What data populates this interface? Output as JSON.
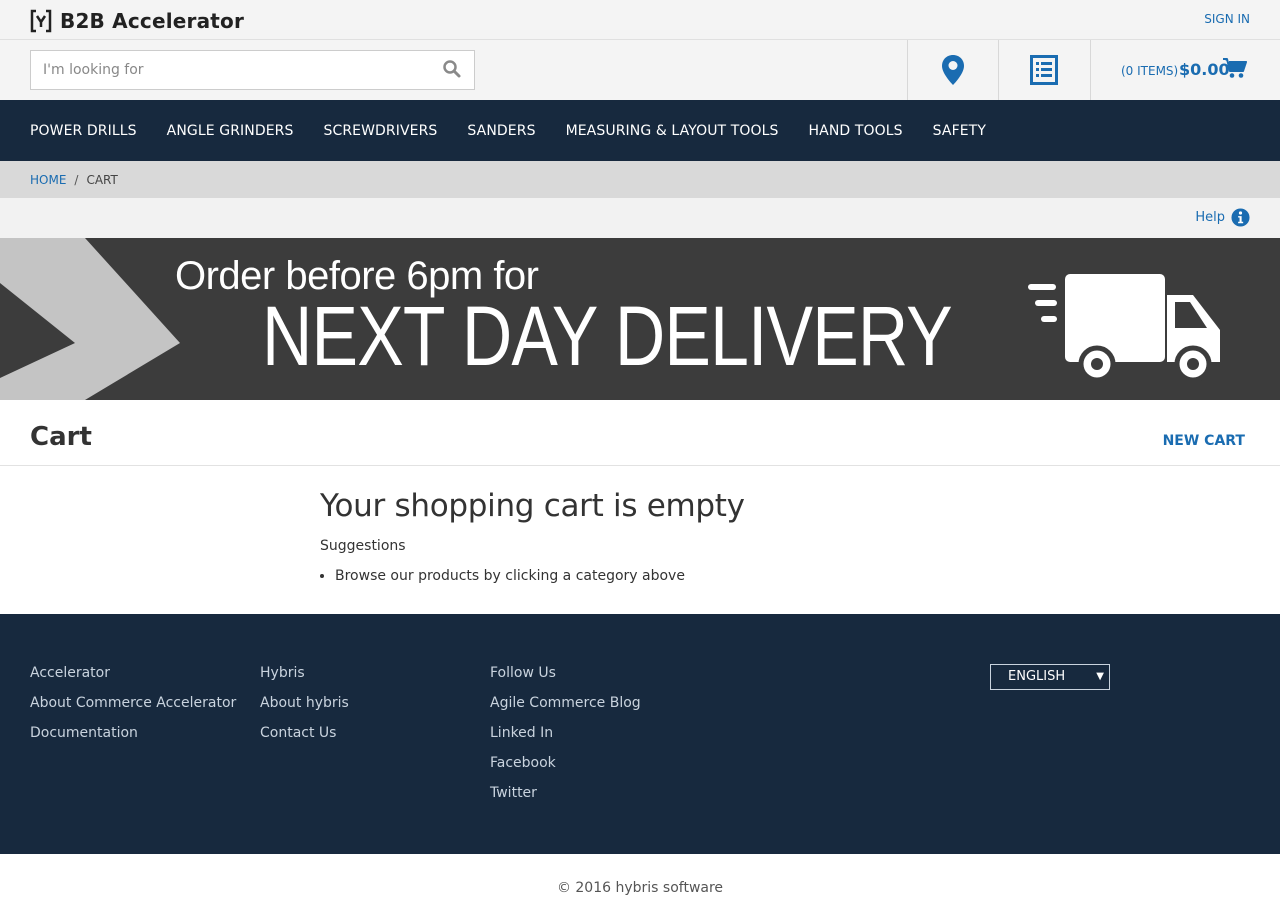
{
  "header": {
    "logo_text": "B2B Accelerator",
    "sign_in": "SIGN IN"
  },
  "search": {
    "placeholder": "I'm looking for"
  },
  "minicart": {
    "items": "(0 ITEMS)",
    "total": "$0.00"
  },
  "nav": {
    "items": [
      "POWER DRILLS",
      "ANGLE GRINDERS",
      "SCREWDRIVERS",
      "SANDERS",
      "MEASURING & LAYOUT TOOLS",
      "HAND TOOLS",
      "SAFETY"
    ]
  },
  "breadcrumb": {
    "home": "HOME",
    "separator": "/",
    "current": "CART"
  },
  "help": {
    "label": "Help"
  },
  "banner": {
    "line1": "Order before 6pm for",
    "line2": "NEXT DAY DELIVERY"
  },
  "cart": {
    "title": "Cart",
    "new_cart": "NEW CART",
    "empty_heading": "Your shopping cart is empty",
    "suggestions_label": "Suggestions",
    "suggestions": [
      "Browse our products by clicking a category above"
    ]
  },
  "footer": {
    "columns": [
      {
        "heading": "Accelerator",
        "links": [
          "About Commerce Accelerator",
          "Documentation"
        ]
      },
      {
        "heading": "Hybris",
        "links": [
          "About hybris",
          "Contact Us"
        ]
      },
      {
        "heading": "Follow Us",
        "links": [
          "Agile Commerce Blog",
          "Linked In",
          "Facebook",
          "Twitter"
        ]
      }
    ],
    "language": "ENGLISH",
    "copyright": "© 2016 hybris software"
  },
  "colors": {
    "accent": "#1a6cb1",
    "nav_bg": "#17293e",
    "banner_bg": "#3c3c3c"
  },
  "icons": {
    "store_locator": "map-marker-icon",
    "quick_order": "list-icon",
    "cart": "shopping-cart-icon",
    "help": "info-circle-icon",
    "search": "search-icon",
    "delivery": "truck-icon"
  }
}
